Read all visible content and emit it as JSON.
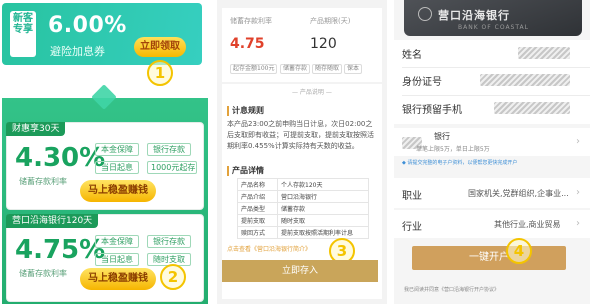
{
  "panel1": {
    "coupon": {
      "tag": "新客专享",
      "rate": "6.00%",
      "subtitle": "避险加息券",
      "claim_button": "立即领取",
      "marker": "1"
    },
    "card1": {
      "caption": "财惠享30天",
      "rate": "4.30%",
      "rate_label": "储蓄存款利率",
      "chips": [
        "本金保障",
        "银行存款",
        "当日起息",
        "1000元起存"
      ],
      "cta": "马上稳盈赚钱"
    },
    "card2": {
      "caption": "营口沿海银行120天",
      "rate": "4.75%",
      "rate_label": "储蓄存款利率",
      "chips": [
        "本金保障",
        "银行存款",
        "当日起息",
        "随时支取"
      ],
      "cta": "马上稳盈赚钱",
      "marker": "2"
    },
    "colors": {
      "accent_green": "#23ad6f",
      "coupon_teal": "#2fc8ad",
      "button_gold": "#f6b500"
    }
  },
  "panel2": {
    "rate_label": "储蓄存款利率",
    "rate": "4.75",
    "amount_label": "产品期限(天)",
    "amount": "120",
    "tags": [
      "起存金额100元",
      "储蓄存款",
      "随存随取",
      "保本"
    ],
    "section_title": "— 产品说明 —",
    "rule_heading": "计息规则",
    "rule_text": "本产品23:00之前申购当日计息，次日02:00之后支取即有收益；可提前支取，提前支取按照活期利率0.455%计算实际持有天数的收益。",
    "detail_heading": "产品详情",
    "table": [
      [
        "产品名称",
        "个人存款120天"
      ],
      [
        "产品介绍",
        "营口沿海银行"
      ],
      [
        "产品类型",
        "储蓄存款"
      ],
      [
        "提前支取",
        "随时支取"
      ],
      [
        "赎回方式",
        "提前支取按照活期利率计息"
      ]
    ],
    "link_text": "点击查看《营口沿海银行简介》",
    "marker": "3",
    "button": "立即存入"
  },
  "panel3": {
    "bank_name": "营口沿海银行",
    "bank_en": "BANK OF COASTAL",
    "fields": [
      "姓名",
      "身份证号",
      "银行预留手机"
    ],
    "bank_row_label": "银行",
    "bank_row_limit": "单笔上限5万，单日上限5万",
    "notice": "◆ 请提交完整的电子户资料，以便帮您更快完成开户",
    "job_label": "职业",
    "job_value": "国家机关,党群组织,企事业...",
    "industry_label": "行业",
    "industry_value": "其他行业,商业贸易",
    "open_button": "一键开户",
    "marker": "4",
    "agree_text": "我已阅读并同意《营口沿海银行开户协议》"
  }
}
